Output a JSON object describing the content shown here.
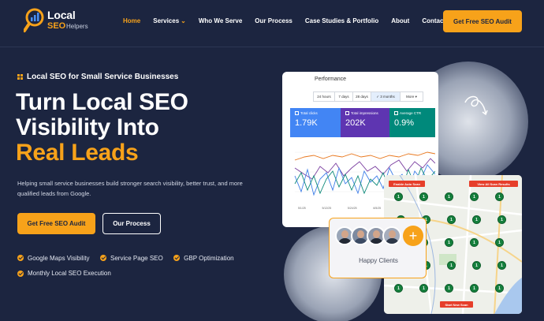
{
  "brand": {
    "name_line1": "Local",
    "name_line2": "SEO",
    "name_suffix": "Helpers",
    "accent": "#f7a21a",
    "background": "#1c2540"
  },
  "nav": {
    "items": [
      {
        "label": "Home",
        "active": true
      },
      {
        "label": "Services",
        "has_dropdown": true
      },
      {
        "label": "Who We Serve"
      },
      {
        "label": "Our Process"
      },
      {
        "label": "Case Studies & Portfolio"
      },
      {
        "label": "About"
      },
      {
        "label": "Contact"
      }
    ],
    "cta_label": "Get Free SEO Audit"
  },
  "hero": {
    "eyebrow": "Local SEO for Small Service Businesses",
    "headline_line1": "Turn Local SEO",
    "headline_line2": "Visibility Into",
    "headline_line3": "Real Leads",
    "description": "Helping small service businesses build stronger search visibility, better trust, and more qualified leads from Google.",
    "primary_button": "Get Free SEO Audit",
    "secondary_button": "Our Process",
    "features": [
      "Google Maps Visibility",
      "Service Page SEO",
      "GBP Optimization",
      "Monthly Local SEO Execution"
    ]
  },
  "performance_card": {
    "title": "Performance",
    "ranges": [
      "24 hours",
      "7 days",
      "28 days",
      "3 months",
      "More"
    ],
    "selected_range": "3 months",
    "metrics": [
      {
        "label": "Total clicks",
        "value": "1.79K",
        "color": "#4285f4"
      },
      {
        "label": "Total impressions",
        "value": "202K",
        "color": "#5e35b1"
      },
      {
        "label": "Average CTR",
        "value": "0.9%",
        "color": "#00897b"
      }
    ],
    "dates": [
      "5/1/25",
      "5/12/25",
      "5/24/25",
      "6/5/25",
      "6/16/25",
      "6/28/25"
    ]
  },
  "map_card": {
    "auto_scan_label": "Enable Auto Scan",
    "results_label": "View All Scan Results",
    "new_scan_label": "Start New Scan",
    "pin_rank": "1"
  },
  "happy_clients": {
    "label": "Happy Clients",
    "plus": "+"
  }
}
